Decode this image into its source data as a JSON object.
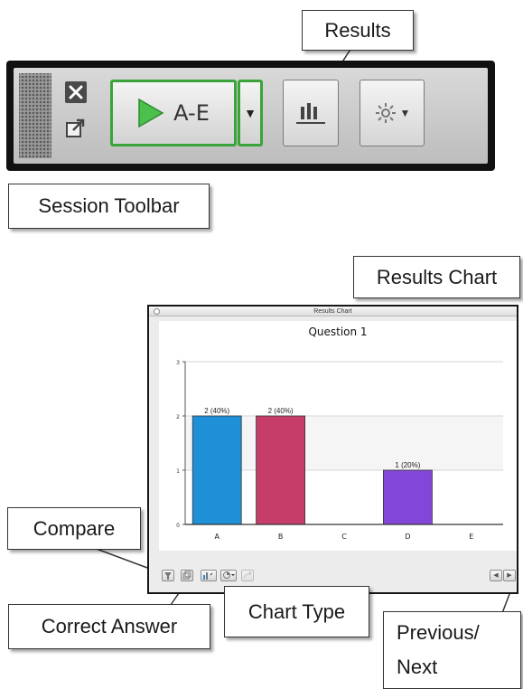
{
  "callouts": {
    "results": "Results",
    "session_toolbar": "Session Toolbar",
    "results_chart": "Results Chart",
    "compare": "Compare",
    "correct_answer": "Correct Answer",
    "chart_type": "Chart Type",
    "previous_next": "Previous/ Next"
  },
  "toolbar": {
    "start_label": "A-E",
    "close_icon": "close-x-icon",
    "popout_icon": "popout-icon",
    "play_icon": "play-triangle-icon",
    "dropdown_icon": "dropdown-arrow-icon",
    "results_icon": "bar-chart-icon",
    "settings_icon": "gear-icon",
    "accent_color": "#3aa43a"
  },
  "chart_window": {
    "title": "Results Chart",
    "footer_icons": [
      "filter-icon",
      "compare-icon",
      "correct-answer-icon",
      "chart-type-icon",
      "share-icon",
      "previous-icon",
      "next-icon"
    ]
  },
  "chart_data": {
    "type": "bar",
    "title": "Question 1",
    "categories": [
      "A",
      "B",
      "C",
      "D",
      "E"
    ],
    "values": [
      2,
      2,
      0,
      1,
      0
    ],
    "labels": [
      "2 (40%)",
      "2 (40%)",
      "",
      "1 (20%)",
      ""
    ],
    "colors": [
      "#1f8fd8",
      "#c63d6a",
      "#999999",
      "#8247d8",
      "#999999"
    ],
    "ylim": [
      0,
      3
    ],
    "yticks": [
      "0",
      "1",
      "2",
      "3"
    ],
    "grid": true
  }
}
